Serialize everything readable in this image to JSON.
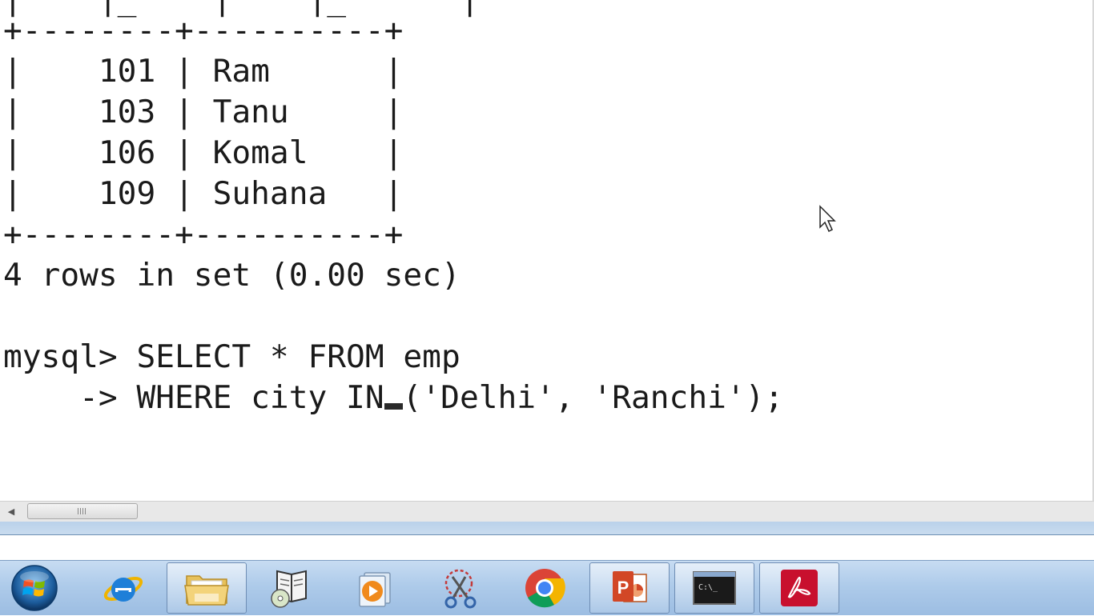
{
  "console": {
    "lines": [
      "|    |_    |    |_      |",
      "+--------+----------+",
      "|    101 | Ram      |",
      "|    103 | Tanu     |",
      "|    106 | Komal    |",
      "|    109 | Suhana   |",
      "+--------+----------+",
      "4 rows in set (0.00 sec)",
      "",
      "mysql> SELECT * FROM emp",
      "    -> WHERE city IN",
      "('Delhi', 'Ranchi');"
    ]
  },
  "taskbar": {
    "items": [
      {
        "name": "start-button",
        "icon": "windows-logo-icon"
      },
      {
        "name": "internet-explorer",
        "icon": "internet-explorer-icon"
      },
      {
        "name": "windows-explorer",
        "icon": "folder-icon",
        "open": true
      },
      {
        "name": "windows-media-center",
        "icon": "book-cd-icon"
      },
      {
        "name": "media-player",
        "icon": "play-icon"
      },
      {
        "name": "snipping-tool",
        "icon": "scissors-icon"
      },
      {
        "name": "google-chrome",
        "icon": "chrome-icon"
      },
      {
        "name": "powerpoint",
        "icon": "powerpoint-icon",
        "open": true
      },
      {
        "name": "command-prompt",
        "icon": "cmd-icon",
        "open": true,
        "label": "C:\\_"
      },
      {
        "name": "adobe-reader",
        "icon": "pdf-icon",
        "open": true
      }
    ]
  },
  "colors": {
    "taskbar": "#aecbea",
    "window_frame": "#b9d1ea",
    "console_text": "#1a1a1a"
  }
}
